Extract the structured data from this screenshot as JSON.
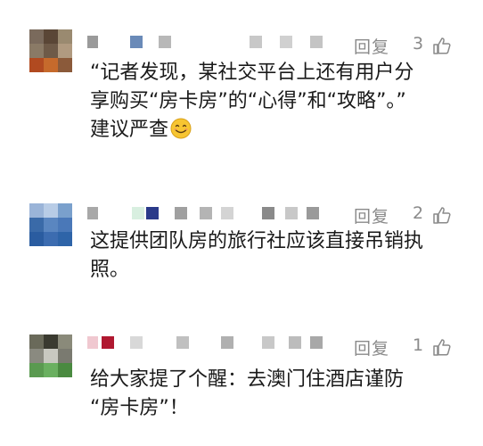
{
  "comments": [
    {
      "reply_label": "回复",
      "likes": "3",
      "text_lines": [
        "“记者发现，某社交平台上还有用户分",
        "享购买“房卡房”的“心得”和“攻略”。”",
        "建议严查"
      ],
      "emoji": "smiling-face-icon"
    },
    {
      "reply_label": "回复",
      "likes": "2",
      "text_lines": [
        "这提供团队房的旅行社应该直接吊销执",
        "照。"
      ]
    },
    {
      "reply_label": "回复",
      "likes": "1",
      "text_lines": [
        "给大家提了个醒：去澳门住酒店谨防",
        "“房卡房”！"
      ]
    }
  ],
  "colors": {
    "meta_gray": "#8a8a8a",
    "text": "#1a1a1a"
  }
}
